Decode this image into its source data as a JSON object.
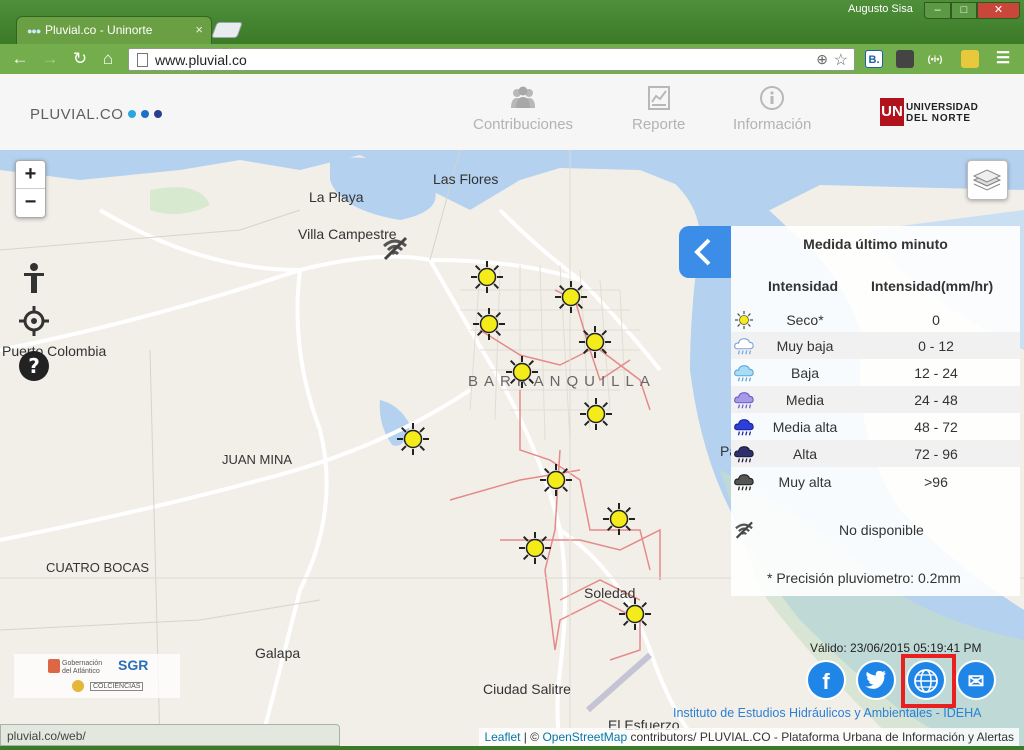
{
  "browser": {
    "tab_title": "Pluvial.co - Uninorte",
    "tab_close": "×",
    "profile": "Augusto Sisa",
    "url": "www.pluvial.co",
    "status_url": "pluvial.co/web/",
    "window_controls": {
      "minimize": "–",
      "maximize": "□",
      "close": "✕"
    },
    "extensions": [
      "B.",
      "",
      "(•i•)",
      ""
    ]
  },
  "header": {
    "logo": "PLUVIAL.CO",
    "logo_dot_colors": [
      "#29a8e0",
      "#1f6fc5",
      "#2c3e8f"
    ],
    "nav": [
      {
        "label": "Contribuciones",
        "icon": "people-icon"
      },
      {
        "label": "Reporte",
        "icon": "report-icon"
      },
      {
        "label": "Información",
        "icon": "info-icon"
      }
    ],
    "university": {
      "mark": "UN",
      "line1": "UNIVERSIDAD",
      "line2": "DEL NORTE"
    }
  },
  "map": {
    "zoom_in": "+",
    "zoom_out": "−",
    "places": [
      {
        "name": "Las Flores",
        "cls": ""
      },
      {
        "name": "La Playa",
        "cls": ""
      },
      {
        "name": "Villa Campestre",
        "cls": ""
      },
      {
        "name": "Puerto Colombia",
        "cls": ""
      },
      {
        "name": "BARRANQUILLA",
        "cls": "city"
      },
      {
        "name": "JUAN MINA",
        "cls": "small"
      },
      {
        "name": "CUATRO BOCAS",
        "cls": "small"
      },
      {
        "name": "Soledad",
        "cls": ""
      },
      {
        "name": "Galapa",
        "cls": ""
      },
      {
        "name": "Ciudad Salitre",
        "cls": ""
      },
      {
        "name": "El Esfuerzo",
        "cls": ""
      },
      {
        "name": "Palermo",
        "cls": ""
      }
    ],
    "stations": [
      {
        "status": "seco"
      },
      {
        "status": "seco"
      },
      {
        "status": "seco"
      },
      {
        "status": "seco"
      },
      {
        "status": "seco"
      },
      {
        "status": "seco"
      },
      {
        "status": "seco"
      },
      {
        "status": "seco"
      },
      {
        "status": "seco"
      },
      {
        "status": "seco"
      },
      {
        "status": "seco"
      },
      {
        "status": "seco"
      }
    ],
    "offline_station": "wifi-off-icon",
    "attribution": {
      "leaflet": "Leaflet",
      "sep": " | © ",
      "osm": "OpenStreetMap",
      "rest": " contributors/ PLUVIAL.CO - Plataforma Urbana de Información y Alertas"
    }
  },
  "legend": {
    "title": "Medida último minuto",
    "col_intensity": "Intensidad",
    "col_mmhr": "Intensidad(mm/hr)",
    "rows": [
      {
        "name": "Seco*",
        "range": "0",
        "icon": "sun-icon"
      },
      {
        "name": "Muy baja",
        "range": "0 - 12",
        "icon": "cloud-very-light-icon"
      },
      {
        "name": "Baja",
        "range": "12 - 24",
        "icon": "cloud-light-rain-icon"
      },
      {
        "name": "Media",
        "range": "24 - 48",
        "icon": "cloud-medium-rain-icon"
      },
      {
        "name": "Media alta",
        "range": "48 - 72",
        "icon": "cloud-heavy-rain-icon"
      },
      {
        "name": "Alta",
        "range": "72 - 96",
        "icon": "cloud-high-rain-icon"
      },
      {
        "name": "Muy alta",
        "range": ">96",
        "icon": "cloud-very-high-rain-icon"
      }
    ],
    "not_available": "No disponible",
    "note": "* Precisión pluviometro: 0.2mm"
  },
  "footer": {
    "valid": "Válido: 23/06/2015 05:19:41 PM",
    "institute": "Instituto de Estudios Hidráulicos y Ambientales - IDEHA",
    "social": {
      "facebook": "f",
      "email": "✉"
    },
    "sponsors": {
      "gob": "Gobernación del Atlántico",
      "sgr": "SGR",
      "colciencias": "COLCIENCIAS"
    }
  }
}
